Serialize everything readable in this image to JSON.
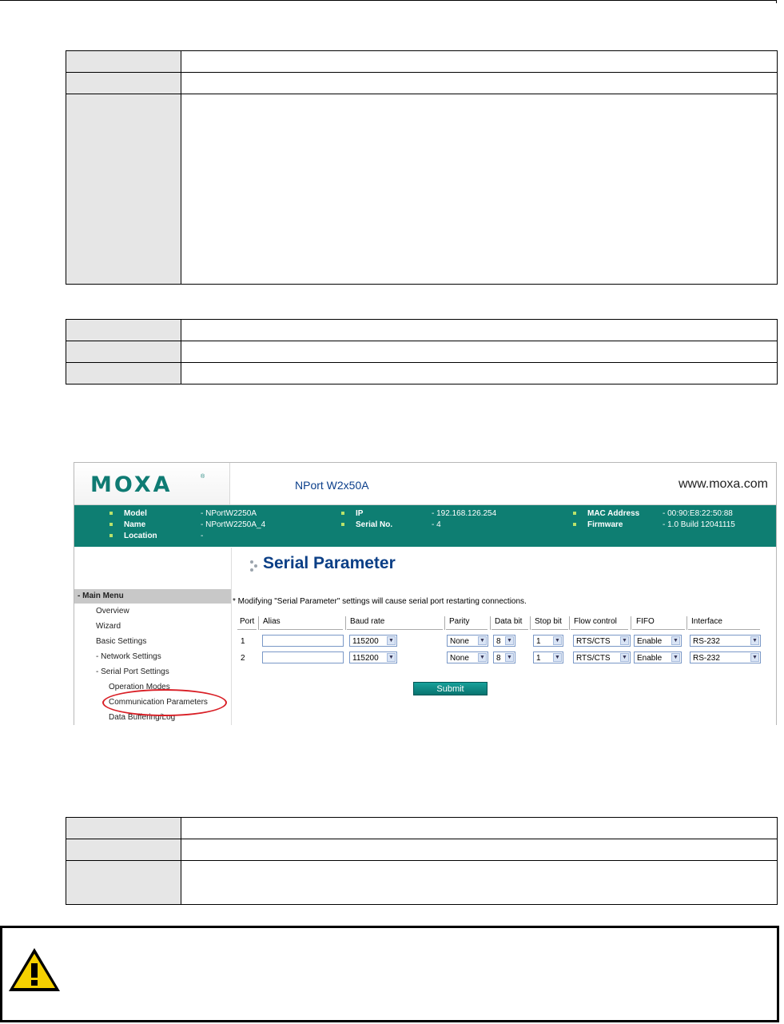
{
  "shot": {
    "logo_text": "MOXA",
    "logo_reg": "®",
    "product": "NPort W2x50A",
    "website": "www.moxa.com",
    "info": {
      "model_label": "Model",
      "model_value": "- NPortW2250A",
      "name_label": "Name",
      "name_value": "- NPortW2250A_4",
      "location_label": "Location",
      "location_value": "-",
      "ip_label": "IP",
      "ip_value": "- 192.168.126.254",
      "serial_label": "Serial No.",
      "serial_value": "- 4",
      "mac_label": "MAC Address",
      "mac_value": "- 00:90:E8:22:50:88",
      "firmware_label": "Firmware",
      "firmware_value": "- 1.0 Build 12041115"
    },
    "menu": {
      "main": "- Main Menu",
      "items": [
        "Overview",
        "Wizard",
        "Basic Settings",
        "- Network Settings",
        "- Serial Port Settings",
        "Operation Modes",
        "Communication Parameters",
        "Data Buffering/Log"
      ]
    },
    "page_title": "Serial Parameter",
    "notice": "* Modifying \"Serial Parameter\" settings will cause serial port restarting connections.",
    "columns": [
      "Port",
      "Alias",
      "Baud rate",
      "Parity",
      "Data bit",
      "Stop bit",
      "Flow control",
      "FIFO",
      "Interface"
    ],
    "rows": [
      {
        "port": "1",
        "baud": "115200",
        "parity": "None",
        "data_bit": "8",
        "stop_bit": "1",
        "flow": "RTS/CTS",
        "fifo": "Enable",
        "interface": "RS-232"
      },
      {
        "port": "2",
        "baud": "115200",
        "parity": "None",
        "data_bit": "8",
        "stop_bit": "1",
        "flow": "RTS/CTS",
        "fifo": "Enable",
        "interface": "RS-232"
      }
    ],
    "submit": "Submit",
    "arrow": "▼"
  }
}
